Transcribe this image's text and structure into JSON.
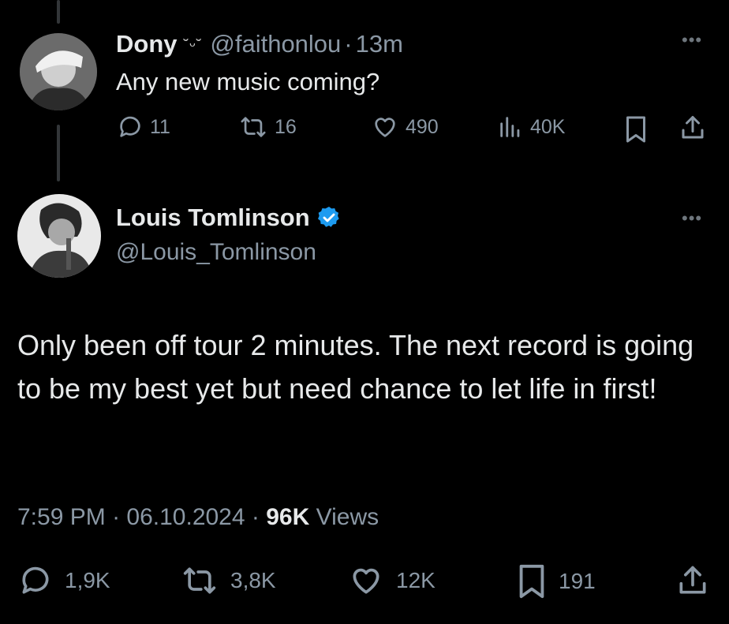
{
  "parent": {
    "name": "Dony",
    "emoji": "˘ᵕ˘",
    "handle": "@faithonlou",
    "sep": "·",
    "time": "13m",
    "text": "Any new music coming?",
    "more": "•••",
    "actions": {
      "replies": "11",
      "reposts": "16",
      "likes": "490",
      "views": "40K"
    }
  },
  "tweet": {
    "name": "Louis Tomlinson",
    "handle": "@Louis_Tomlinson",
    "more": "•••",
    "text": "Only been off tour 2 minutes. The next record is going to be my best yet but need chance to let life in first!",
    "time": "7:59 PM",
    "date": "06.10.2024",
    "views_count": "96K",
    "views_label": "Views",
    "actions": {
      "replies": "1,9K",
      "reposts": "3,8K",
      "likes": "12K",
      "bookmarks": "191"
    }
  },
  "colors": {
    "background": "#000000",
    "text": "#e7e9ea",
    "secondary": "#8b98a5",
    "verified": "#1d9bf0",
    "thread_line": "#333639"
  }
}
